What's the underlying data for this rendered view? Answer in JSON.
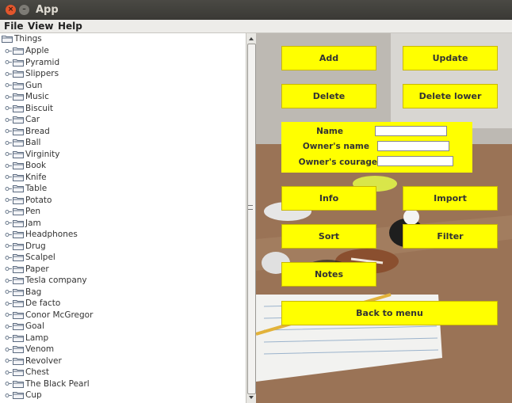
{
  "window": {
    "title": "App",
    "close_glyph": "×",
    "minimize_glyph": "–"
  },
  "menu": {
    "file": "File",
    "view": "View",
    "help": "Help"
  },
  "tree": {
    "root": "Things",
    "items": [
      "Apple",
      "Pyramid",
      "Slippers",
      "Gun",
      "Music",
      "Biscuit",
      "Car",
      "Bread",
      "Ball",
      "Virginity",
      "Book",
      "Knife",
      "Table",
      "Potato",
      "Pen",
      "Jam",
      "Headphones",
      "Drug",
      "Scalpel",
      "Paper",
      "Tesla company",
      "Bag",
      "De facto",
      "Conor McGregor",
      "Goal",
      "Lamp",
      "Venom",
      "Revolver",
      "Chest",
      "The Black Pearl",
      "Cup"
    ]
  },
  "buttons": {
    "add": "Add",
    "update": "Update",
    "delete": "Delete",
    "delete_lower": "Delete lower",
    "info": "Info",
    "import": "Import",
    "sort": "Sort",
    "filter": "Filter",
    "notes": "Notes",
    "back_to_menu": "Back to menu"
  },
  "form": {
    "name_label": "Name",
    "owner_name_label": "Owner's name",
    "owner_courage_label": "Owner's courage",
    "name_value": "",
    "owner_name_value": "",
    "owner_courage_value": ""
  },
  "colors": {
    "button_yellow": "#ffff00",
    "titlebar": "#3c3b37",
    "close_button": "#e3562c"
  },
  "icons": {
    "folder": "folder-icon",
    "expander": "expand-handle-icon"
  }
}
